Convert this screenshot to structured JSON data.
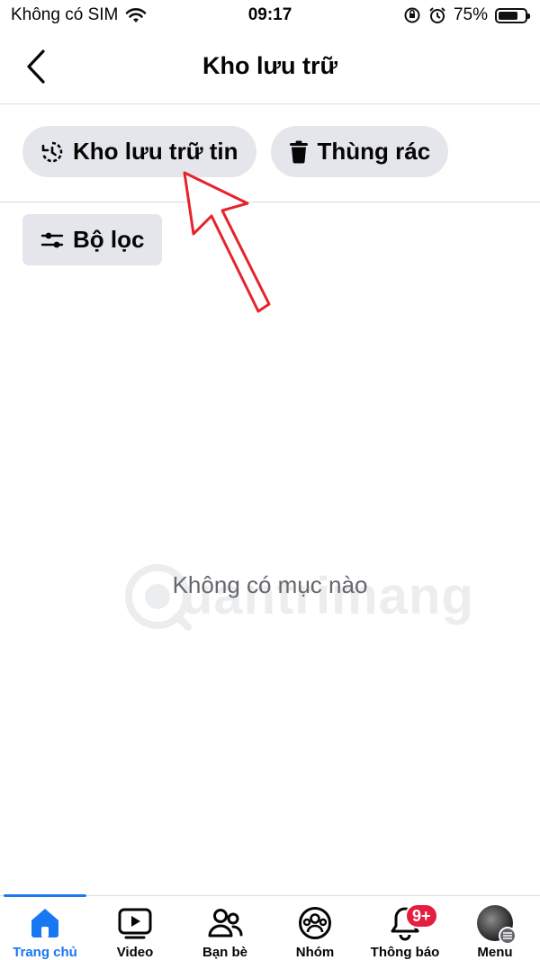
{
  "status_bar": {
    "carrier": "Không có SIM",
    "time": "09:17",
    "battery": "75%",
    "battery_level": 0.75,
    "icons": [
      "wifi-icon",
      "orientation-lock-icon",
      "alarm-icon",
      "battery-icon"
    ]
  },
  "header": {
    "title": "Kho lưu trữ",
    "back_icon": "chevron-left-icon"
  },
  "tabs": [
    {
      "label": "Kho lưu trữ tin",
      "icon": "story-archive-icon"
    },
    {
      "label": "Thùng rác",
      "icon": "trash-icon"
    }
  ],
  "filter": {
    "label": "Bộ lọc",
    "icon": "sliders-icon"
  },
  "empty_state": {
    "message": "Không có mục nào"
  },
  "watermark": {
    "text": "uantrimang"
  },
  "bottom_nav": {
    "items": [
      {
        "label": "Trang chủ",
        "icon": "home-icon",
        "active": true
      },
      {
        "label": "Video",
        "icon": "video-icon",
        "active": false
      },
      {
        "label": "Bạn bè",
        "icon": "friends-icon",
        "active": false
      },
      {
        "label": "Nhóm",
        "icon": "groups-icon",
        "active": false
      },
      {
        "label": "Thông báo",
        "icon": "bell-icon",
        "active": false
      },
      {
        "label": "Menu",
        "icon": "avatar-menu-icon",
        "active": false
      }
    ],
    "notification_badge": "9+"
  },
  "colors": {
    "accent": "#1877f2",
    "chip_bg": "#e4e6eb",
    "badge": "#e41e3f",
    "annotation": "#e5232a"
  }
}
